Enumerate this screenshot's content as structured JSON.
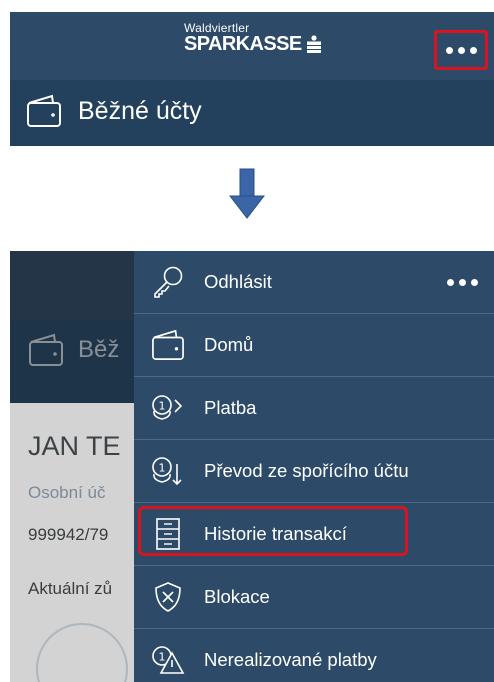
{
  "top": {
    "logo_small": "Waldviertler",
    "logo_big": "SPARKASSE",
    "title": "Běžné účty"
  },
  "bottom": {
    "title_partial": "Běž",
    "name_partial": "JAN TE",
    "account_type_partial": "Osobní úč",
    "account_number_partial": "999942/79",
    "balance_label_partial": "Aktuální zů"
  },
  "menu": {
    "items": [
      {
        "label": "Odhlásit",
        "icon": "key-icon"
      },
      {
        "label": "Domů",
        "icon": "wallet-icon"
      },
      {
        "label": "Platba",
        "icon": "payment-icon"
      },
      {
        "label": "Převod ze spořícího účtu",
        "icon": "savings-transfer-icon"
      },
      {
        "label": "Historie transakcí",
        "icon": "history-icon"
      },
      {
        "label": "Blokace",
        "icon": "shield-icon"
      },
      {
        "label": "Nerealizované platby",
        "icon": "warning-payment-icon"
      }
    ]
  },
  "colors": {
    "header": "#2d4a68",
    "highlight": "#d9141c",
    "arrow": "#3a66a8"
  }
}
